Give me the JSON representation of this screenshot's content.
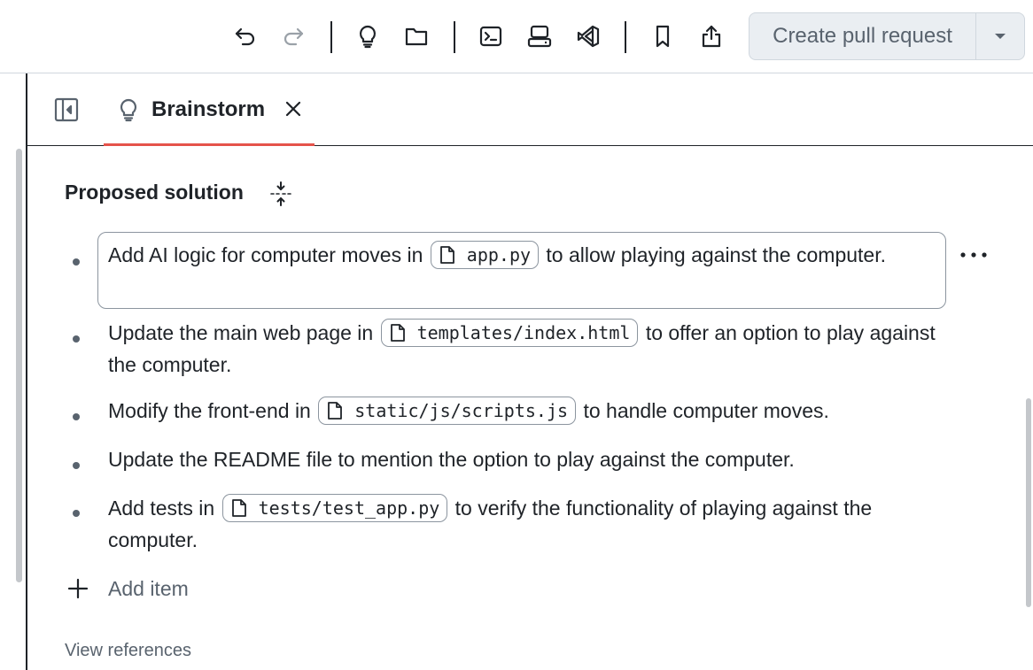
{
  "toolbar": {
    "icons": [
      "undo-icon",
      "redo-icon",
      "lightbulb-icon",
      "folder-icon",
      "terminal-icon",
      "codespace-icon",
      "vscode-icon",
      "bookmark-icon",
      "share-icon"
    ],
    "create_pr_label": "Create pull request"
  },
  "tabs": [
    {
      "label": "Brainstorm",
      "icon": "lightbulb-icon",
      "active": true
    }
  ],
  "section": {
    "title": "Proposed solution",
    "items": [
      {
        "before": "Add AI logic for computer moves in",
        "file": "app.py",
        "after": "to allow playing against the computer."
      },
      {
        "before": "Update the main web page in",
        "file": "templates/index.html",
        "after": "to offer an option to play against the computer."
      },
      {
        "before": "Modify the front-end in",
        "file": "static/js/scripts.js",
        "after": "to handle computer moves."
      },
      {
        "text": "Update the README file to mention the option to play against the computer."
      },
      {
        "before": "Add tests in",
        "file": "tests/test_app.py",
        "after": "to verify the functionality of playing against the computer."
      }
    ],
    "add_item_label": "Add item",
    "view_references_label": "View references"
  },
  "colors": {
    "accent_underline": "#e5534b",
    "button_bg": "#eaeef2",
    "muted_text": "#59636e",
    "border": "#d0d7de"
  }
}
